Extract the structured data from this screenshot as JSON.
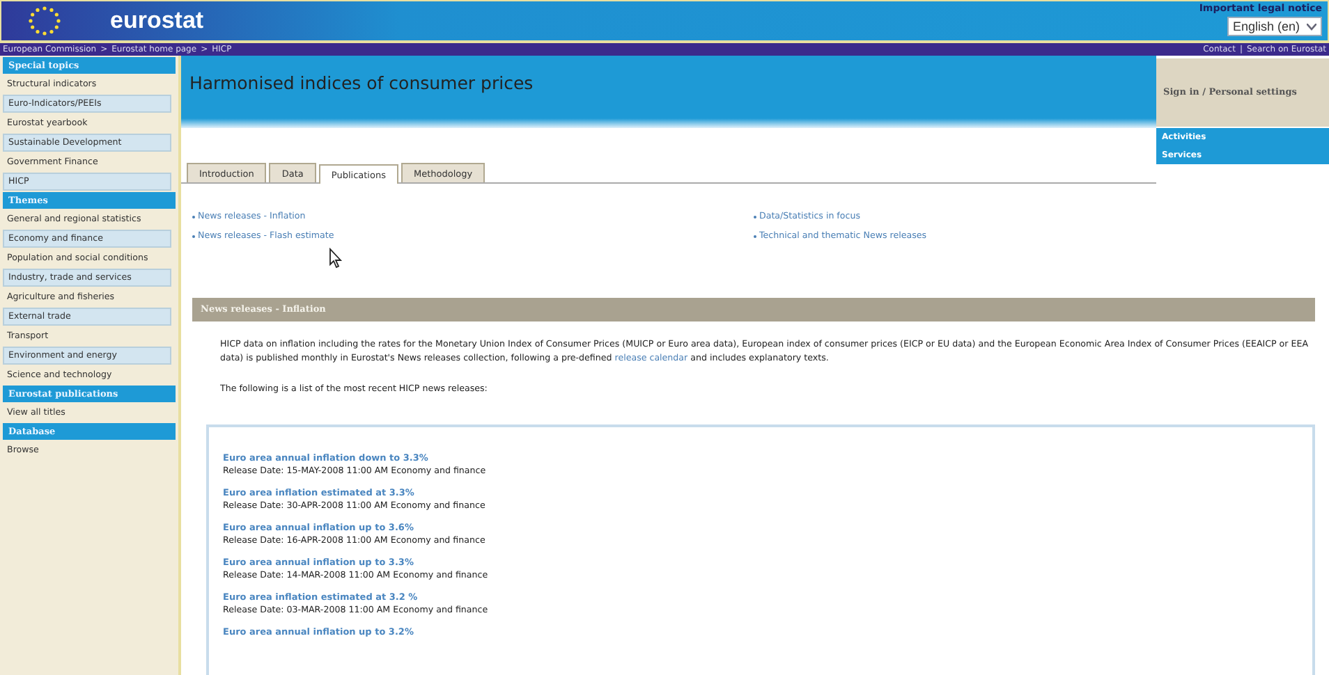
{
  "header": {
    "logo_text": "eurostat",
    "legal_notice": "Important legal notice",
    "language": "English (en)"
  },
  "breadcrumb": {
    "items": [
      "European Commission",
      "Eurostat home page",
      "HICP"
    ],
    "separator": ">",
    "right_links": [
      "Contact",
      "Search on Eurostat"
    ],
    "right_separator": "|"
  },
  "sidebar": {
    "items": [
      {
        "kind": "heading",
        "label": "Special topics"
      },
      {
        "kind": "item",
        "label": "Structural indicators"
      },
      {
        "kind": "boxed",
        "label": "Euro-Indicators/PEEIs"
      },
      {
        "kind": "item",
        "label": "Eurostat yearbook"
      },
      {
        "kind": "boxed",
        "label": "Sustainable Development"
      },
      {
        "kind": "item",
        "label": "Government Finance"
      },
      {
        "kind": "boxed",
        "label": "HICP"
      },
      {
        "kind": "heading",
        "label": "Themes"
      },
      {
        "kind": "item",
        "label": "General and regional statistics"
      },
      {
        "kind": "boxed",
        "label": "Economy and finance"
      },
      {
        "kind": "item",
        "label": "Population and social conditions"
      },
      {
        "kind": "boxed",
        "label": "Industry, trade and services"
      },
      {
        "kind": "item",
        "label": "Agriculture and fisheries"
      },
      {
        "kind": "boxed",
        "label": "External trade"
      },
      {
        "kind": "item",
        "label": "Transport"
      },
      {
        "kind": "boxed",
        "label": "Environment and energy"
      },
      {
        "kind": "item",
        "label": "Science and technology"
      },
      {
        "kind": "heading",
        "label": "Eurostat publications"
      },
      {
        "kind": "item",
        "label": "View all titles"
      },
      {
        "kind": "heading",
        "label": "Database"
      },
      {
        "kind": "item",
        "label": "Browse"
      }
    ]
  },
  "page_title": "Harmonised indices of consumer prices",
  "user_panel": {
    "sign_in": "Sign in / Personal settings",
    "links": [
      "Activities",
      "Services"
    ]
  },
  "tabs": [
    {
      "label": "Introduction",
      "selected": false
    },
    {
      "label": "Data",
      "selected": false
    },
    {
      "label": "Publications",
      "selected": true
    },
    {
      "label": "Methodology",
      "selected": false
    }
  ],
  "quick_links": {
    "left": [
      "News releases - Inflation",
      "News releases - Flash estimate"
    ],
    "right": [
      "Data/Statistics in focus",
      "Technical and thematic News releases"
    ]
  },
  "section": {
    "title": "News releases - Inflation",
    "intro_before": "HICP data on inflation including the rates for the Monetary Union Index of Consumer Prices (MUICP or Euro area data), European index of consumer prices (EICP or EU data) and the European Economic Area Index of Consumer Prices (EEAICP or EEA data) is published monthly in Eurostat's News releases collection, following a pre-defined",
    "intro_link": "release calendar",
    "intro_after": "and includes explanatory texts.",
    "list_intro": "The following is a list of the most recent HICP news releases:"
  },
  "releases": [
    {
      "title": "Euro area annual inflation down to 3.3%",
      "meta": "Release Date: 15-MAY-2008 11:00 AM Economy and finance"
    },
    {
      "title": "Euro area inflation estimated at 3.3%",
      "meta": "Release Date: 30-APR-2008 11:00 AM Economy and finance"
    },
    {
      "title": "Euro area annual inflation up to 3.6%",
      "meta": "Release Date: 16-APR-2008 11:00 AM Economy and finance"
    },
    {
      "title": "Euro area annual inflation up to 3.3%",
      "meta": "Release Date: 14-MAR-2008 11:00 AM Economy and finance"
    },
    {
      "title": "Euro area inflation estimated at 3.2 %",
      "meta": "Release Date: 03-MAR-2008 11:00 AM Economy and finance"
    },
    {
      "title": "Euro area annual inflation up to 3.2%"
    }
  ]
}
